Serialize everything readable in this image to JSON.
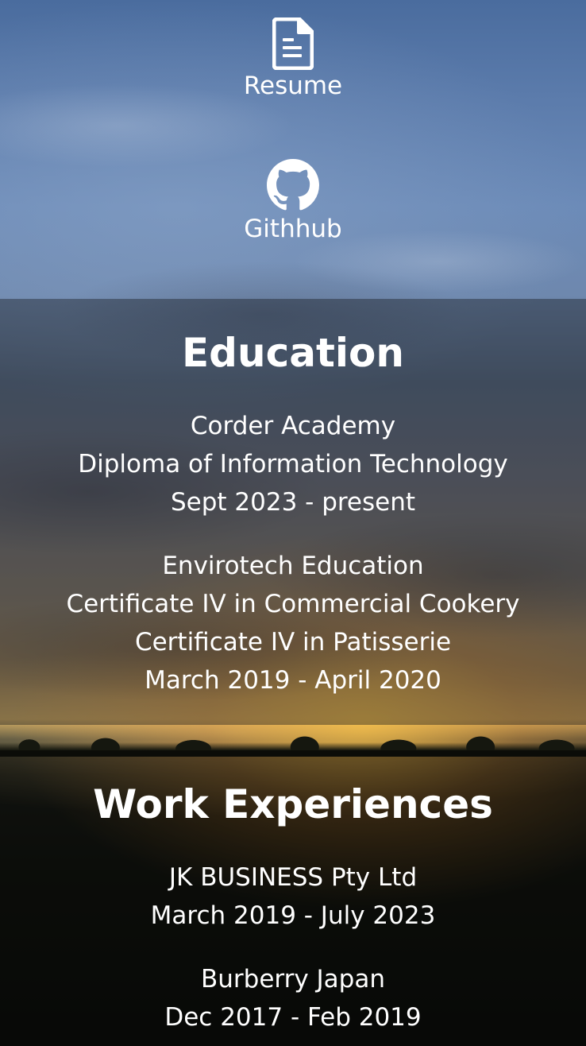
{
  "links": {
    "resume": {
      "label": "Resume",
      "icon": "document-icon"
    },
    "github": {
      "label": "Githhub",
      "icon": "github-icon"
    }
  },
  "education": {
    "heading": "Education",
    "entries": [
      {
        "lines": [
          "Corder Academy",
          "Diploma of Information Technology",
          "Sept 2023 - present"
        ]
      },
      {
        "lines": [
          "Envirotech Education",
          "Certificate IV in Commercial Cookery",
          "Certificate IV in Patisserie",
          "March 2019 - April 2020"
        ]
      }
    ]
  },
  "work": {
    "heading": "Work Experiences",
    "entries": [
      {
        "lines": [
          "JK BUSINESS Pty Ltd",
          "March 2019 - July 2023"
        ]
      },
      {
        "lines": [
          "Burberry Japan",
          "Dec 2017 - Feb 2019"
        ]
      }
    ]
  }
}
